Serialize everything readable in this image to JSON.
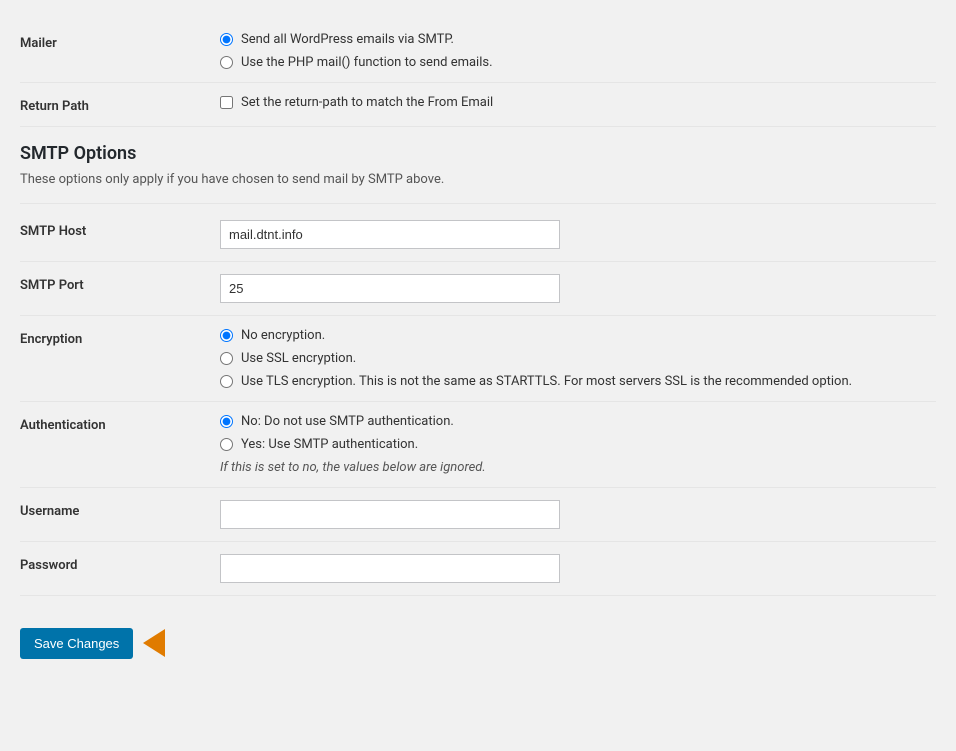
{
  "mailer": {
    "label": "Mailer",
    "option1": "Send all WordPress emails via SMTP.",
    "option2": "Use the PHP mail() function to send emails.",
    "option1_selected": true,
    "option2_selected": false
  },
  "return_path": {
    "label": "Return Path",
    "checkbox_label": "Set the return-path to match the From Email",
    "checked": false
  },
  "smtp_options": {
    "heading": "SMTP Options",
    "description": "These options only apply if you have chosen to send mail by SMTP above."
  },
  "smtp_host": {
    "label": "SMTP Host",
    "value": "mail.dtnt.info",
    "placeholder": ""
  },
  "smtp_port": {
    "label": "SMTP Port",
    "value": "25",
    "placeholder": ""
  },
  "encryption": {
    "label": "Encryption",
    "option1": "No encryption.",
    "option2": "Use SSL encryption.",
    "option3": "Use TLS encryption. This is not the same as STARTTLS. For most servers SSL is the recommended option.",
    "option1_selected": true
  },
  "authentication": {
    "label": "Authentication",
    "option1": "No: Do not use SMTP authentication.",
    "option2": "Yes: Use SMTP authentication.",
    "note": "If this is set to no, the values below are ignored.",
    "option1_selected": true
  },
  "username": {
    "label": "Username",
    "value": "",
    "placeholder": ""
  },
  "password": {
    "label": "Password",
    "value": "",
    "placeholder": ""
  },
  "footer": {
    "save_button": "Save Changes"
  }
}
